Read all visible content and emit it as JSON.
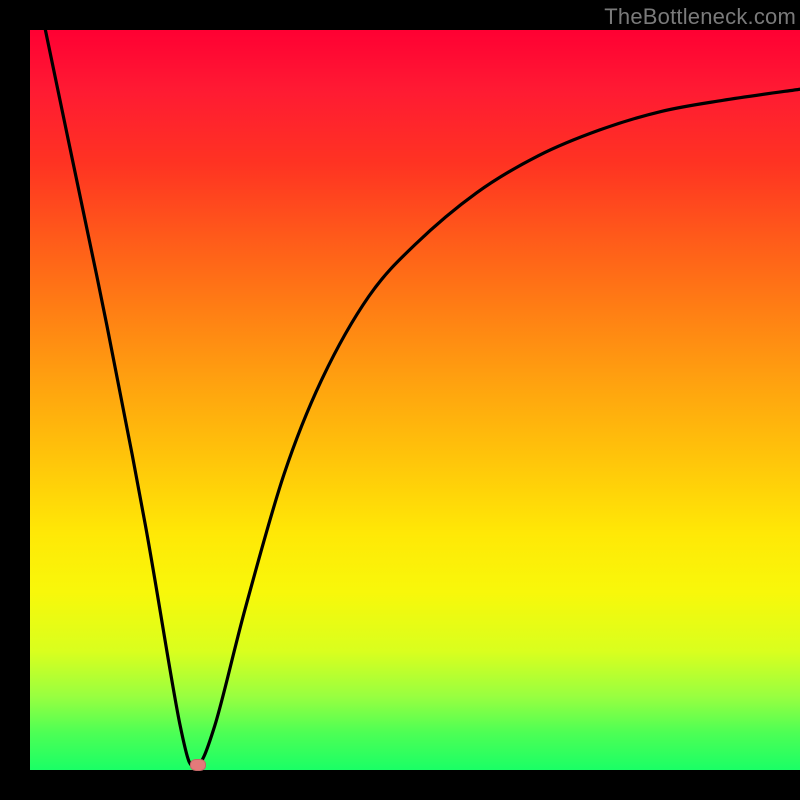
{
  "watermark": "TheBottleneck.com",
  "chart_data": {
    "type": "line",
    "title": "",
    "xlabel": "",
    "ylabel": "",
    "xlim": [
      0,
      100
    ],
    "ylim": [
      0,
      100
    ],
    "series": [
      {
        "name": "curve",
        "x": [
          2,
          5,
          10,
          15,
          19.5,
          21.5,
          24,
          28,
          33,
          38,
          44,
          50,
          58,
          66,
          74,
          82,
          90,
          100
        ],
        "y": [
          100,
          85,
          60,
          33,
          6,
          0.5,
          6,
          22,
          40,
          53,
          64,
          71,
          78,
          83,
          86.5,
          89,
          90.5,
          92
        ]
      }
    ],
    "marker": {
      "x": 21.8,
      "y": 0.7
    },
    "background_gradient": {
      "direction": "top-to-bottom",
      "stops": [
        {
          "pos": 0.0,
          "color": "#ff0033"
        },
        {
          "pos": 0.38,
          "color": "#ff7f14"
        },
        {
          "pos": 0.68,
          "color": "#ffe806"
        },
        {
          "pos": 1.0,
          "color": "#1aff66"
        }
      ]
    }
  }
}
